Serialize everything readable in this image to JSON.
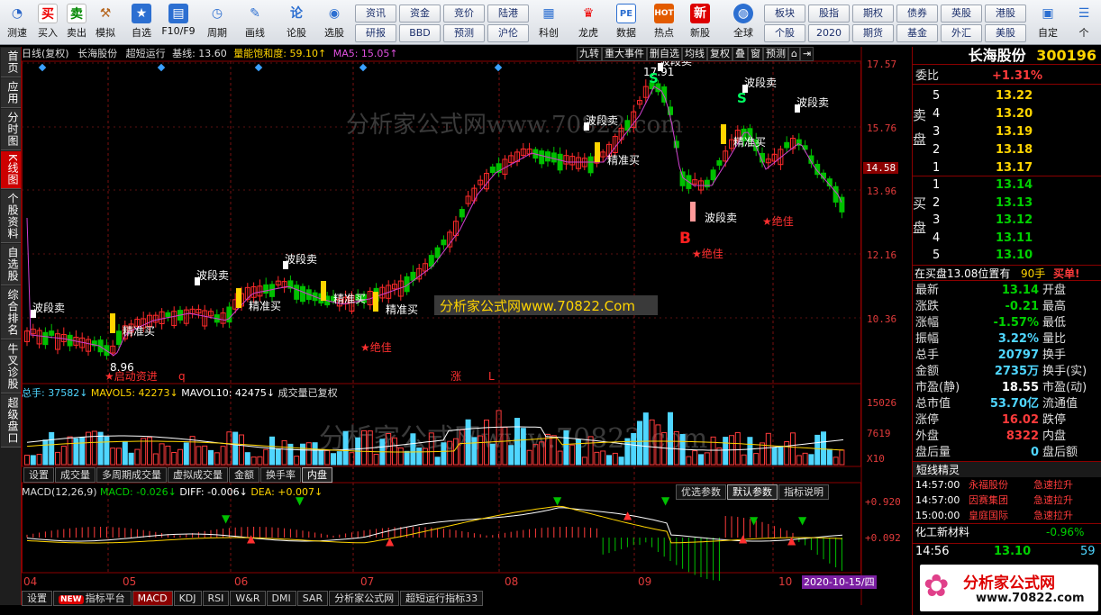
{
  "toolbar": {
    "left": [
      {
        "label": "测速",
        "icon": "speed-icon"
      },
      {
        "label": "买入",
        "icon": "buy-icon"
      },
      {
        "label": "卖出",
        "icon": "sell-icon"
      },
      {
        "label": "模拟",
        "icon": "hammer-icon"
      },
      {
        "label": "自选",
        "icon": "star-icon"
      },
      {
        "label": "F10/F9",
        "icon": "f10-icon"
      },
      {
        "label": "周期",
        "icon": "clock-icon"
      },
      {
        "label": "画线",
        "icon": "pen-icon"
      },
      {
        "label": "论股",
        "icon": "chat-icon"
      },
      {
        "label": "选股",
        "icon": "select-icon"
      }
    ],
    "buy_glyph": "买",
    "sell_glyph": "卖",
    "grid_top": [
      "资讯",
      "资金",
      "竞价",
      "陆港"
    ],
    "grid_bottom": [
      "研报",
      "BBD",
      "预测",
      "沪伦"
    ],
    "mid": [
      {
        "label": "科创",
        "icon": "chart-icon"
      },
      {
        "label": "龙虎",
        "icon": "dragon-icon"
      },
      {
        "label": "数据",
        "icon": "pe-icon"
      },
      {
        "label": "热点",
        "icon": "hot-icon"
      },
      {
        "label": "新股",
        "icon": "new-icon"
      },
      {
        "label": "全球",
        "icon": "globe-icon"
      }
    ],
    "pe_glyph": "PE",
    "hot_glyph": "HOT",
    "grid2_top": [
      "板块",
      "股指",
      "期权",
      "债券",
      "英股",
      "港股"
    ],
    "grid2_bottom": [
      "个股",
      "2020",
      "期货",
      "基金",
      "外汇",
      "美股"
    ],
    "right": [
      {
        "label": "自定",
        "icon": "custom-icon"
      },
      {
        "label": "个",
        "icon": "menu-icon"
      }
    ]
  },
  "left_tabs": [
    "首页",
    "应用",
    "分时图",
    "K线图",
    "个股资料",
    "自选股",
    "综合排名",
    "牛叉诊股",
    "超级盘口"
  ],
  "active_tab": "K线图",
  "main_header": {
    "period": "日线(复权)",
    "stock": "长海股份",
    "indicator": "超短运行",
    "base": "基线: 13.60",
    "energy": "量能饱和度: 59.10↑",
    "ma5": "MA5: 15.05↑"
  },
  "kline_buttons": [
    "九转",
    "重大事件",
    "删自选",
    "均线",
    "复权",
    "叠",
    "窗",
    "预测",
    "⌂",
    "⇥"
  ],
  "watermark": "分析家公式网www.70822.com",
  "watermark_box": "分析家公式网www.70822.Com",
  "price_axis": [
    "17.57",
    "15.76",
    "13.96",
    "12.16",
    "10.36"
  ],
  "current_price": "14.58",
  "annotations": {
    "sell": "波段卖",
    "buy": "精准买",
    "best": "★绝佳",
    "start": "★启动资进",
    "low": "8.96",
    "zhang": "涨",
    "L": "L",
    "q": "q",
    "B": "B",
    "S": "S",
    "high": "17.91"
  },
  "volume_header": {
    "total": "总手: 37582↓",
    "mavol5": "MAVOL5: 42273↓",
    "mavol10": "MAVOL10: 42475↓",
    "note": "成交量已复权"
  },
  "volume_axis": [
    "15026",
    "7619",
    "X10"
  ],
  "volume_tabs": [
    "设置",
    "成交量",
    "多周期成交量",
    "虚拟成交量",
    "金额",
    "换手率",
    "内盘"
  ],
  "macd_header": {
    "name": "MACD(12,26,9)",
    "macd": "MACD: -0.026↓",
    "diff": "DIFF: -0.006↓",
    "dea": "DEA: +0.007↓"
  },
  "macd_buttons": [
    "优选参数",
    "默认参数",
    "指标说明"
  ],
  "macd_axis": [
    "+0.920",
    "+0.092"
  ],
  "x_axis": [
    "04",
    "05",
    "06",
    "07",
    "08",
    "09",
    "10"
  ],
  "date_badge": "2020-10-15/四",
  "bottom_tabs": [
    "设置",
    "指标平台",
    "MACD",
    "KDJ",
    "RSI",
    "W&R",
    "DMI",
    "SAR",
    "分析家公式网",
    "超短运行指标33"
  ],
  "new_badge": "NEW",
  "quote": {
    "title": "长海股份",
    "code": "300196",
    "weibi_label": "委比",
    "weibi": "+1.31%",
    "sell_label": "卖盘",
    "buy_label": "买盘",
    "asks": [
      {
        "lvl": "5",
        "price": "13.22"
      },
      {
        "lvl": "4",
        "price": "13.20"
      },
      {
        "lvl": "3",
        "price": "13.19"
      },
      {
        "lvl": "2",
        "price": "13.18"
      },
      {
        "lvl": "1",
        "price": "13.17"
      }
    ],
    "bids": [
      {
        "lvl": "1",
        "price": "13.14"
      },
      {
        "lvl": "2",
        "price": "13.13"
      },
      {
        "lvl": "3",
        "price": "13.12"
      },
      {
        "lvl": "4",
        "price": "13.11"
      },
      {
        "lvl": "5",
        "price": "13.10"
      }
    ],
    "position_note": "在买盘13.08位置有",
    "position_qty": "90手",
    "position_action": "买单!",
    "stats": [
      {
        "l": "最新",
        "v": "13.14",
        "vc": "g",
        "r": "开盘"
      },
      {
        "l": "涨跌",
        "v": "-0.21",
        "vc": "g",
        "r": "最高"
      },
      {
        "l": "涨幅",
        "v": "-1.57%",
        "vc": "g",
        "r": "最低"
      },
      {
        "l": "振幅",
        "v": "3.22%",
        "vc": "c",
        "r": "量比"
      },
      {
        "l": "总手",
        "v": "20797",
        "vc": "c",
        "r": "换手"
      },
      {
        "l": "金额",
        "v": "2735万",
        "vc": "c",
        "r": "换手(实)"
      },
      {
        "l": "市盈(静)",
        "v": "18.55",
        "vc": "w",
        "r": "市盈(动)"
      },
      {
        "l": "总市值",
        "v": "53.70亿",
        "vc": "c",
        "r": "流通值"
      },
      {
        "l": "涨停",
        "v": "16.02",
        "vc": "r",
        "r": "跌停"
      },
      {
        "l": "外盘",
        "v": "8322",
        "vc": "r",
        "r": "内盘"
      },
      {
        "l": "盘后量",
        "v": "0",
        "vc": "c",
        "r": "盘后额"
      }
    ],
    "short_title": "短线精灵",
    "short_rows": [
      {
        "t": "14:57:00",
        "s": "永福股份",
        "a": "急速拉升"
      },
      {
        "t": "14:57:00",
        "s": "因赛集团",
        "a": "急速拉升"
      },
      {
        "t": "15:00:00",
        "s": "皇庭国际",
        "a": "急速拉升"
      }
    ],
    "industry": "化工新材料",
    "industry_chg": "-0.96%",
    "tick_time": "14:56",
    "tick_price": "13.10",
    "tick_vol": "59",
    "logo_text": "分析家公式网",
    "logo_url": "www.70822.com"
  },
  "colors": {
    "up": "#ff3b3b",
    "down": "#00c000",
    "ma": "#d040d0",
    "bg": "#000000"
  }
}
